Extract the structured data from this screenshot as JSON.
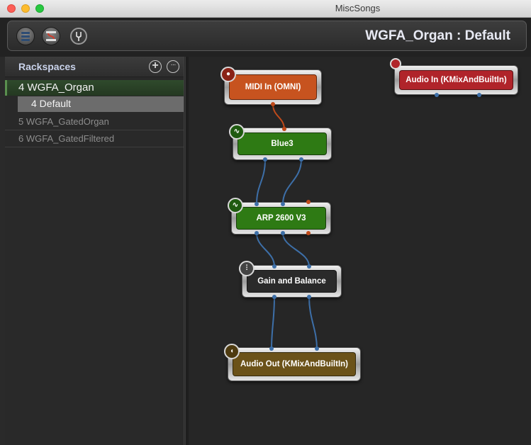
{
  "window": {
    "title": "MiscSongs"
  },
  "toolbar": {
    "rackspace_view_label": "Rackspace view",
    "wiring_view_label": "Wiring view",
    "tuner_label": "Tuner",
    "title": "WGFA_Organ : Default"
  },
  "sidebar": {
    "header": "Rackspaces",
    "add_symbol": "+",
    "more_symbol": "···",
    "active_rackspace": "4 WGFA_Organ",
    "active_variation": "4   Default",
    "rackspaces": [
      {
        "label": "5 WGFA_GatedOrgan"
      },
      {
        "label": "6 WGFA_GatedFiltered"
      }
    ]
  },
  "canvas": {
    "plugins": [
      {
        "label": "MIDI In (OMNI)",
        "icon": "midi-din-icon",
        "color": "#c7531f"
      },
      {
        "label": "Audio In (KMixAndBuiltIn)",
        "icon": "audio-input-icon",
        "color": "#b0242a"
      },
      {
        "label": "Blue3",
        "icon": "waveform-icon",
        "color": "#2e7a14"
      },
      {
        "label": "ARP 2600 V3",
        "icon": "waveform-icon",
        "color": "#2e7a14"
      },
      {
        "label": "Gain and Balance",
        "icon": "mixer-faders-icon",
        "color": "#2a2a2a"
      },
      {
        "label": "Audio Out (KMixAndBuiltIn)",
        "icon": "speaker-icon",
        "color": "#6b5219"
      }
    ],
    "wire_colors": {
      "midi": "#c04a1a",
      "audio": "#3d6fa8"
    }
  }
}
